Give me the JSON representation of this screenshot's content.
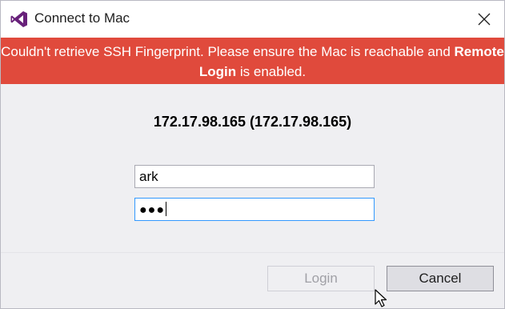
{
  "window": {
    "title": "Connect to Mac"
  },
  "banner": {
    "text_before": "Couldn't retrieve SSH Fingerprint. Please ensure the Mac is reachable and ",
    "bold_text": "Remote Login",
    "text_after": "  is enabled.",
    "color": "#e04a3c"
  },
  "host": {
    "label": "172.17.98.165 (172.17.98.165)"
  },
  "form": {
    "username_value": "ark",
    "password_mask": "●●●"
  },
  "buttons": {
    "login_label": "Login",
    "login_enabled": false,
    "cancel_label": "Cancel"
  },
  "icons": {
    "app": "visual-studio-icon",
    "close": "close-icon",
    "cursor": "mouse-pointer-icon"
  }
}
